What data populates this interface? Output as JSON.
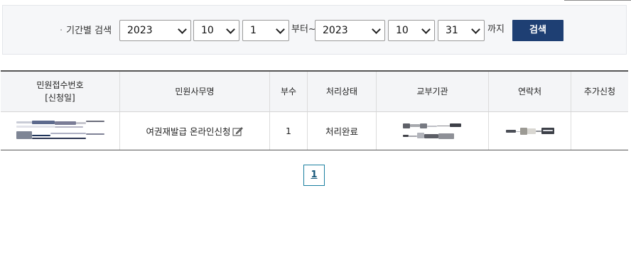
{
  "filter": {
    "label": "기간별 검색",
    "bullet": "·",
    "from": {
      "year": "2023",
      "month": "10",
      "day": "1"
    },
    "from_suffix": "부터~",
    "to": {
      "year": "2023",
      "month": "10",
      "day": "31"
    },
    "to_suffix": "까지",
    "search_label": "검색"
  },
  "table": {
    "headers": {
      "receipt_no": "민원접수번호",
      "receipt_date": "[신청일]",
      "service_name": "민원사무명",
      "copies": "부수",
      "status": "처리상태",
      "issuing_agency": "교부기관",
      "contact": "연락처",
      "additional_request": "추가신청"
    },
    "rows": [
      {
        "service_name": "여권재발급 온라인신청",
        "copies": "1",
        "status": "처리완료"
      }
    ]
  },
  "pagination": {
    "current_page": "1"
  },
  "colors": {
    "search_button": "#1e3f73",
    "pagination_border": "#1a7fa0"
  }
}
